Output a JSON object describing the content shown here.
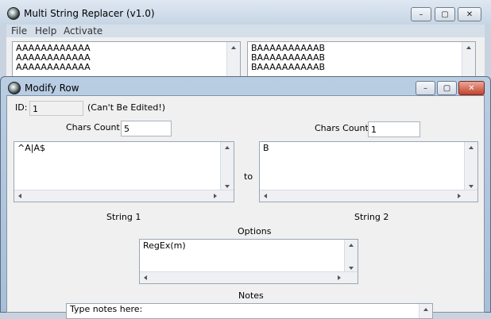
{
  "main_window": {
    "title": "Multi String Replacer (v1.0)",
    "menu": [
      "File",
      "Help",
      "Activate"
    ],
    "left_list": [
      "AAAAAAAAAAAA",
      "AAAAAAAAAAAA",
      "AAAAAAAAAAAA"
    ],
    "right_list": [
      "BAAAAAAAAAAB",
      "BAAAAAAAAAAB",
      "BAAAAAAAAAAB"
    ]
  },
  "dialog": {
    "title": "Modify Row",
    "id_label": "ID:",
    "id_value": "1",
    "id_note": "(Can't Be Edited!)",
    "chars_count1_label": "Chars Count 1:",
    "chars_count1_value": "5",
    "chars_count2_label": "Chars Count 2:",
    "chars_count2_value": "1",
    "string1_value": "^A|A$",
    "to_label": "to",
    "string2_value": "B",
    "string1_label": "String 1",
    "string2_label": "String 2",
    "options_label": "Options",
    "options_value": "RegEx(m)",
    "notes_label": "Notes",
    "notes_placeholder": "Type notes here:"
  },
  "icons": {
    "app": "app-icon",
    "minimize": "minimize-icon",
    "maximize": "maximize-icon",
    "close": "close-icon"
  }
}
